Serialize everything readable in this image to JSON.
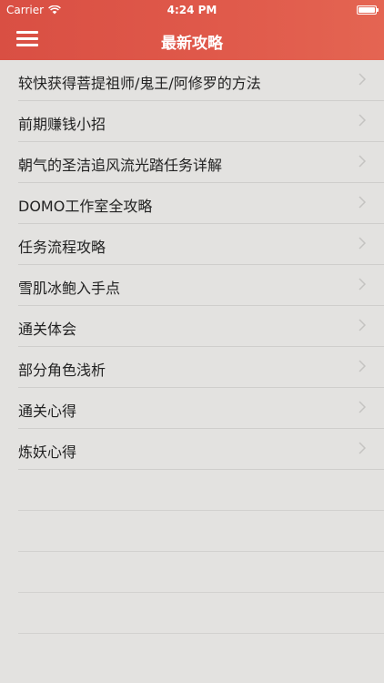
{
  "status_bar": {
    "carrier": "Carrier",
    "time": "4:24 PM"
  },
  "nav": {
    "title": "最新攻略",
    "menu_icon": "hamburger-menu-icon"
  },
  "colors": {
    "header": "#dd5446",
    "background": "#e3e2e0",
    "separator": "#cfcecc",
    "text": "#222222",
    "chevron": "#c4c3c1"
  },
  "list": {
    "items": [
      {
        "label": "较快获得菩提祖师/鬼王/阿修罗的方法"
      },
      {
        "label": "前期赚钱小招"
      },
      {
        "label": "朝气的圣洁追风流光踏任务详解"
      },
      {
        "label": "DOMO工作室全攻略"
      },
      {
        "label": "任务流程攻略"
      },
      {
        "label": "雪肌冰鲍入手点"
      },
      {
        "label": "通关体会"
      },
      {
        "label": "部分角色浅析"
      },
      {
        "label": "通关心得"
      },
      {
        "label": "炼妖心得"
      }
    ]
  }
}
